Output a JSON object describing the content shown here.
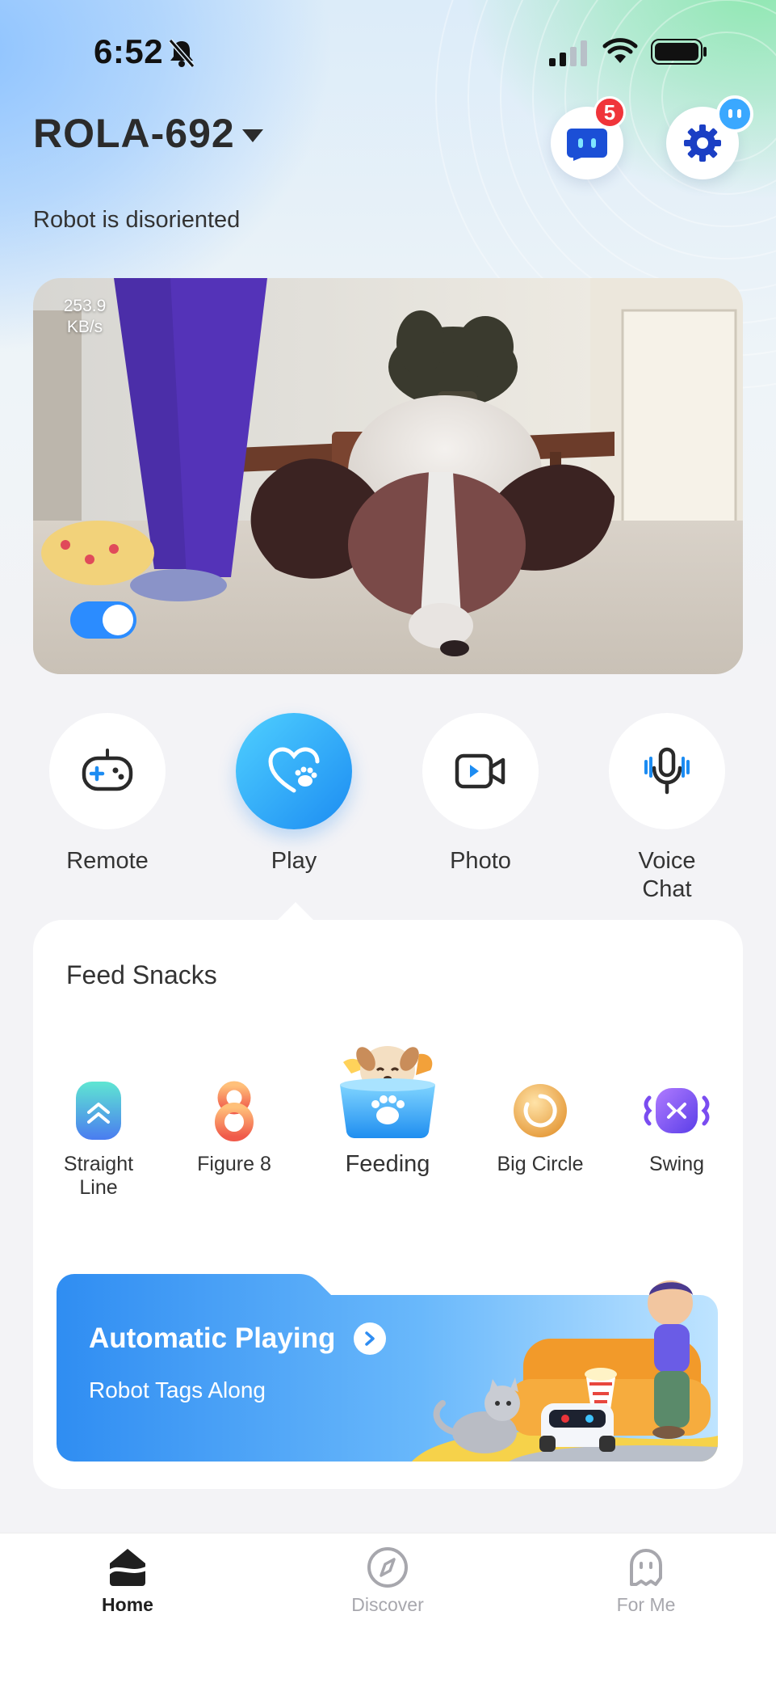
{
  "status_bar": {
    "time": "6:52",
    "silent_icon": "bell-slash-icon",
    "signal_icon": "cellular-signal-icon",
    "wifi_icon": "wifi-icon",
    "battery_icon": "battery-icon"
  },
  "header": {
    "device_name": "ROLA-692",
    "dropdown_icon": "caret-down-icon",
    "messages": {
      "icon": "robot-message-icon",
      "badge": "5"
    },
    "settings": {
      "icon": "gear-icon"
    },
    "status": "Robot is disoriented"
  },
  "video": {
    "rate_value": "253.9",
    "rate_unit": "KB/s",
    "toggle_on": true
  },
  "actions": [
    {
      "label": "Remote",
      "icon": "gamepad-icon",
      "active": false
    },
    {
      "label": "Play",
      "icon": "heart-paw-icon",
      "active": true
    },
    {
      "label": "Photo",
      "icon": "video-camera-icon",
      "active": false
    },
    {
      "label_line1": "Voice",
      "label_line2": "Chat",
      "icon": "microphone-icon",
      "active": false
    }
  ],
  "panel": {
    "title": "Feed Snacks",
    "modes": [
      {
        "label_line1": "Straight",
        "label_line2": "Line",
        "icon": "straight-line-icon"
      },
      {
        "label": "Figure 8",
        "icon": "figure-8-icon"
      },
      {
        "label": "Feeding",
        "icon": "feeding-bowl-icon",
        "selected": true
      },
      {
        "label": "Big Circle",
        "icon": "big-circle-icon"
      },
      {
        "label": "Swing",
        "icon": "swing-icon"
      }
    ],
    "banner": {
      "title": "Automatic Playing",
      "subtitle": "Robot Tags Along",
      "colors": {
        "start": "#2f8df2",
        "end": "#a9dcff"
      }
    }
  },
  "tabbar": {
    "tabs": [
      {
        "label": "Home",
        "icon": "home-icon",
        "active": true
      },
      {
        "label": "Discover",
        "icon": "compass-icon",
        "active": false
      },
      {
        "label": "For Me",
        "icon": "ghost-icon",
        "active": false
      }
    ]
  },
  "colors": {
    "accent": "#1c8cf2",
    "badge": "#f0343a",
    "text": "#333333"
  }
}
